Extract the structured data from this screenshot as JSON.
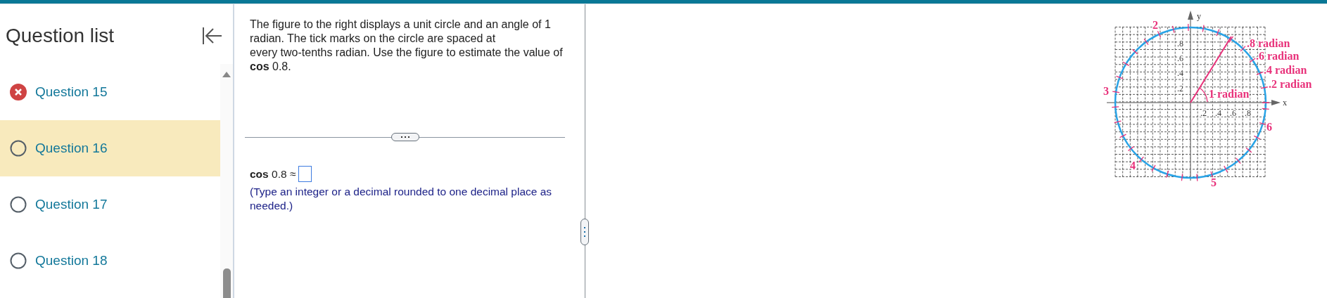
{
  "sidebar": {
    "title": "Question list",
    "items": [
      {
        "label": "Question 15",
        "incorrect": true,
        "selected": false
      },
      {
        "label": "Question 16",
        "incorrect": false,
        "selected": true
      },
      {
        "label": "Question 17",
        "incorrect": false,
        "selected": false
      },
      {
        "label": "Question 18",
        "incorrect": false,
        "selected": false
      }
    ]
  },
  "question": {
    "text": "The figure to the right displays a unit circle and an angle of 1 radian. The tick marks on the circle are spaced at\nevery two-tenths radian. Use the figure to estimate the value of **cos** 0.8.",
    "answer_prompt": "**cos** 0.8 ≈",
    "hint": "(Type an integer or a decimal rounded to one decimal place as needed.)"
  },
  "figure": {
    "labels": [
      {
        "kind": "radian",
        "text": ".8 radian"
      },
      {
        "kind": "radian",
        "text": ".6 radian"
      },
      {
        "kind": "radian",
        "text": ".4 radian"
      },
      {
        "kind": "radian",
        "text": ".2 radian"
      },
      {
        "kind": "radian",
        "text": "1 radian"
      },
      {
        "kind": "radian",
        "text": "2"
      },
      {
        "kind": "radian",
        "text": "3"
      },
      {
        "kind": "radian",
        "text": "4"
      },
      {
        "kind": "radian",
        "text": "5"
      },
      {
        "kind": "radian",
        "text": "6"
      },
      {
        "kind": "axis",
        "text": ".8"
      },
      {
        "kind": "axis",
        "text": ".6"
      },
      {
        "kind": "axis",
        "text": ".4"
      },
      {
        "kind": "axis",
        "text": ".2"
      },
      {
        "kind": "axis",
        "text": ".2"
      },
      {
        "kind": "axis",
        "text": ".4"
      },
      {
        "kind": "axis",
        "text": ".6"
      },
      {
        "kind": "axis",
        "text": ".8"
      },
      {
        "kind": "axis",
        "text": "x"
      },
      {
        "kind": "axis",
        "text": "y"
      }
    ]
  }
}
